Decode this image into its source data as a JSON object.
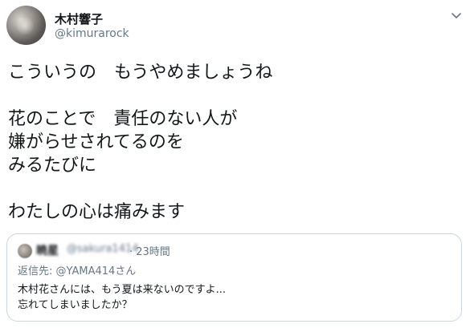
{
  "author": {
    "display_name": "木村響子",
    "handle": "@kimurarock"
  },
  "tweet": {
    "text": "こういうの　もうやめましょうね\n\n花のことで　責任のない人が\n嫌がらせされてるのを\nみるたびに\n\nわたしの心は痛みます"
  },
  "quoted_tweet": {
    "display_name": "暁星",
    "handle": "@sakura1414",
    "time": "· 23時間",
    "reply_label": "返信先:",
    "reply_to": "@YAMA414さん",
    "text": "木村花さんには、もう夏は来ないのですよ...\n忘れてしまいましたか？"
  },
  "icons": {
    "menu": "chevron-down-icon"
  },
  "colors": {
    "text_primary": "#14171a",
    "text_secondary": "#657786",
    "border": "#ccd6dd"
  }
}
